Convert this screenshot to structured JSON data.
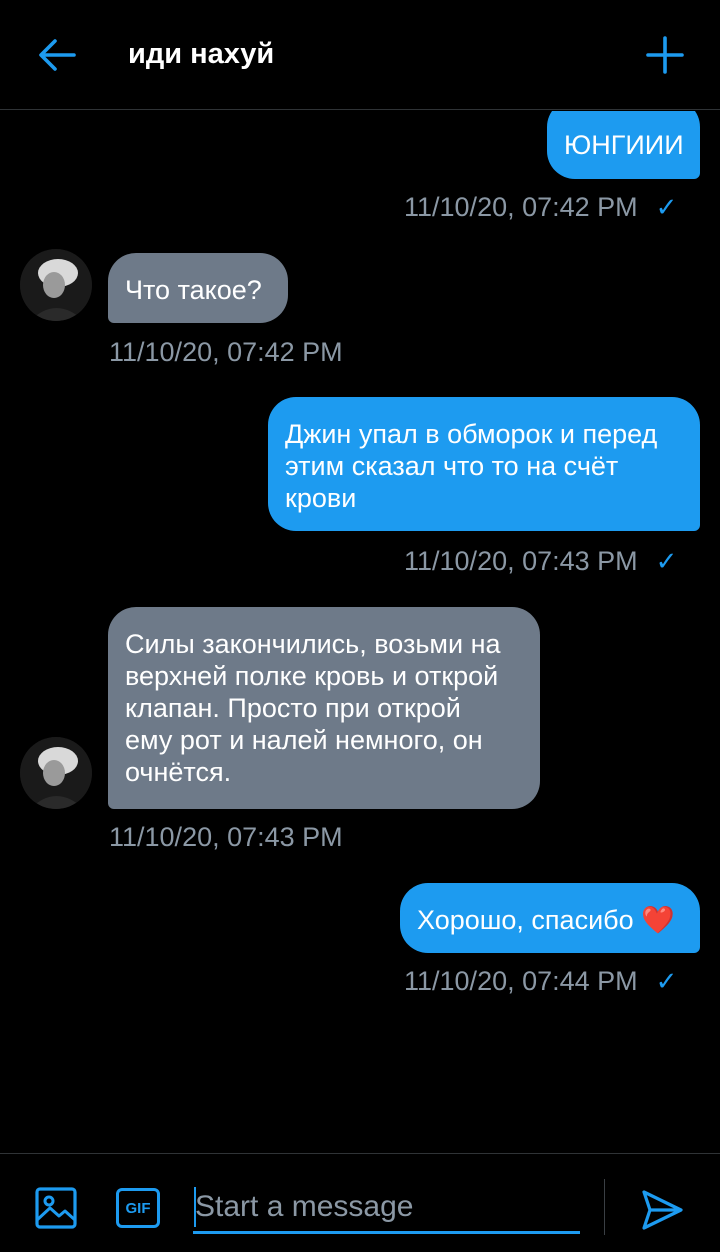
{
  "header": {
    "title": "иди нахуй",
    "back_icon": "arrow-left-icon",
    "add_icon": "plus-icon"
  },
  "messages": [
    {
      "direction": "outgoing",
      "lines": [
        "ЮНГИИИ"
      ],
      "timestamp": "11/10/20, 07:42 PM",
      "read": true
    },
    {
      "direction": "incoming",
      "lines": [
        "Что такое?"
      ],
      "timestamp": "11/10/20, 07:42 PM"
    },
    {
      "direction": "outgoing",
      "lines": [
        "Джин упал в обморок и перед",
        "этим сказал что то на счёт",
        "крови"
      ],
      "timestamp": "11/10/20, 07:43 PM",
      "read": true
    },
    {
      "direction": "incoming",
      "lines": [
        "Силы закончились, возьми на",
        "верхней полке кровь и открой",
        "клапан. Просто при открой",
        "ему рот и налей немного, он",
        "очнётся."
      ],
      "timestamp": "11/10/20, 07:43 PM"
    },
    {
      "direction": "outgoing",
      "lines": [
        "Хорошо, спасибо ❤️"
      ],
      "timestamp": "11/10/20, 07:44 PM",
      "read": true
    }
  ],
  "composer": {
    "placeholder": "Start a message",
    "gif_label": "GIF",
    "image_icon": "image-icon",
    "send_icon": "send-icon"
  },
  "colors": {
    "accent": "#1d9bf0",
    "incoming_bubble": "#6e7a89",
    "background": "#000000",
    "timestamp": "#8b98a5"
  }
}
